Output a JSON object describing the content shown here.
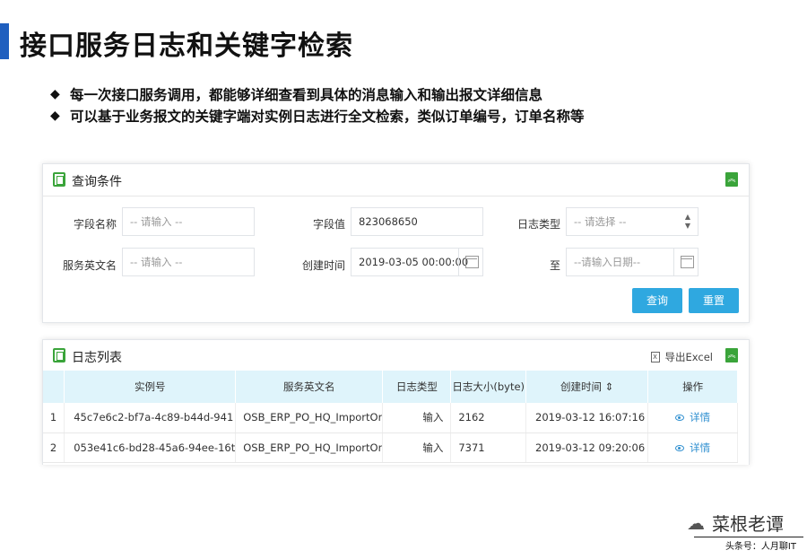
{
  "slide": {
    "title": "接口服务日志和关键字检索",
    "bullets": [
      "每一次接口服务调用，都能够详细查看到具体的消息输入和输出报文详细信息",
      "可以基于业务报文的关键字端对实例日志进行全文检索，类似订单编号，订单名称等"
    ],
    "bullet_symbol": "◆"
  },
  "query": {
    "title": "查询条件",
    "collapse_icon": "double-chevron-up-icon",
    "fields": {
      "field_name": {
        "label": "字段名称",
        "placeholder": "-- 请输入 --"
      },
      "field_value": {
        "label": "字段值",
        "value": "823068650"
      },
      "log_type": {
        "label": "日志类型",
        "placeholder": "-- 请选择 --"
      },
      "service_name": {
        "label": "服务英文名",
        "placeholder": "-- 请输入 --"
      },
      "create_time": {
        "label": "创建时间",
        "value": "2019-03-05 00:00:00"
      },
      "to": {
        "label": "至",
        "placeholder": "--请输入日期--"
      }
    },
    "buttons": {
      "search": "查询",
      "reset": "重置"
    }
  },
  "logs": {
    "title": "日志列表",
    "export_label": "导出Excel",
    "columns": [
      "实例号",
      "服务英文名",
      "日志类型",
      "日志大小(byte)",
      "创建时间 ⇕",
      "操作"
    ],
    "rows": [
      {
        "idx": "1",
        "instance": "45c7e6c2-bf7a-4c89-b44d-941",
        "service": "OSB_ERP_PO_HQ_ImportOr",
        "type": "输入",
        "size": "2162",
        "time": "2019-03-12 16:07:16",
        "action": "详情"
      },
      {
        "idx": "2",
        "instance": "053e41c6-bd28-45a6-94ee-16t",
        "service": "OSB_ERP_PO_HQ_ImportOr",
        "type": "输入",
        "size": "7371",
        "time": "2019-03-12 09:20:06",
        "action": "详情"
      }
    ]
  },
  "watermark": {
    "name": "菜根老谭",
    "sub": "头条号：人月聊IT"
  },
  "colors": {
    "accent": "#1f5fbf",
    "button": "#2fa8e0",
    "header_bg": "#dff4fb",
    "green": "#3aa43a",
    "link": "#2f8fd0"
  }
}
